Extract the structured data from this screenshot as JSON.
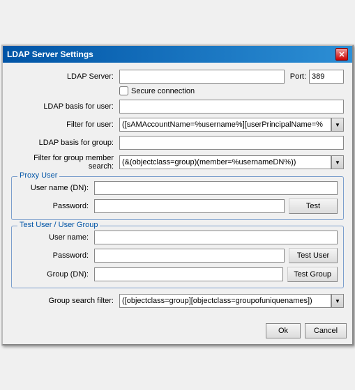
{
  "window": {
    "title": "LDAP Server Settings",
    "close_label": "✕"
  },
  "form": {
    "ldap_server_label": "LDAP Server:",
    "ldap_server_value": "",
    "port_label": "Port:",
    "port_value": "389",
    "secure_label": "Secure connection",
    "ldap_basis_user_label": "LDAP basis for user:",
    "ldap_basis_user_value": "",
    "filter_user_label": "Filter for user:",
    "filter_user_value": "([sAMAccountName=%username%][userPrincipalName=%",
    "ldap_basis_group_label": "LDAP basis for group:",
    "ldap_basis_group_value": "",
    "filter_group_label": "Filter for group member search:",
    "filter_group_value": "(&(objectclass=group)(member=%usernameDN%))",
    "filter_group_options": [
      "(&(objectclass=group)(member=%usernameDN%))"
    ]
  },
  "proxy_user": {
    "title": "Proxy User",
    "username_label": "User name (DN):",
    "username_value": "",
    "password_label": "Password:",
    "password_value": "",
    "test_btn": "Test"
  },
  "test_user": {
    "title": "Test User / User Group",
    "username_label": "User name:",
    "username_value": "",
    "password_label": "Password:",
    "password_value": "",
    "group_label": "Group (DN):",
    "group_value": "",
    "test_user_btn": "Test User",
    "test_group_btn": "Test Group"
  },
  "group_search": {
    "label": "Group search filter:",
    "value": "([objectclass=group][objectclass=groupofuniquenames])",
    "options": [
      "([objectclass=group][objectclass=groupofuniquenames])"
    ]
  },
  "buttons": {
    "ok": "Ok",
    "cancel": "Cancel"
  }
}
